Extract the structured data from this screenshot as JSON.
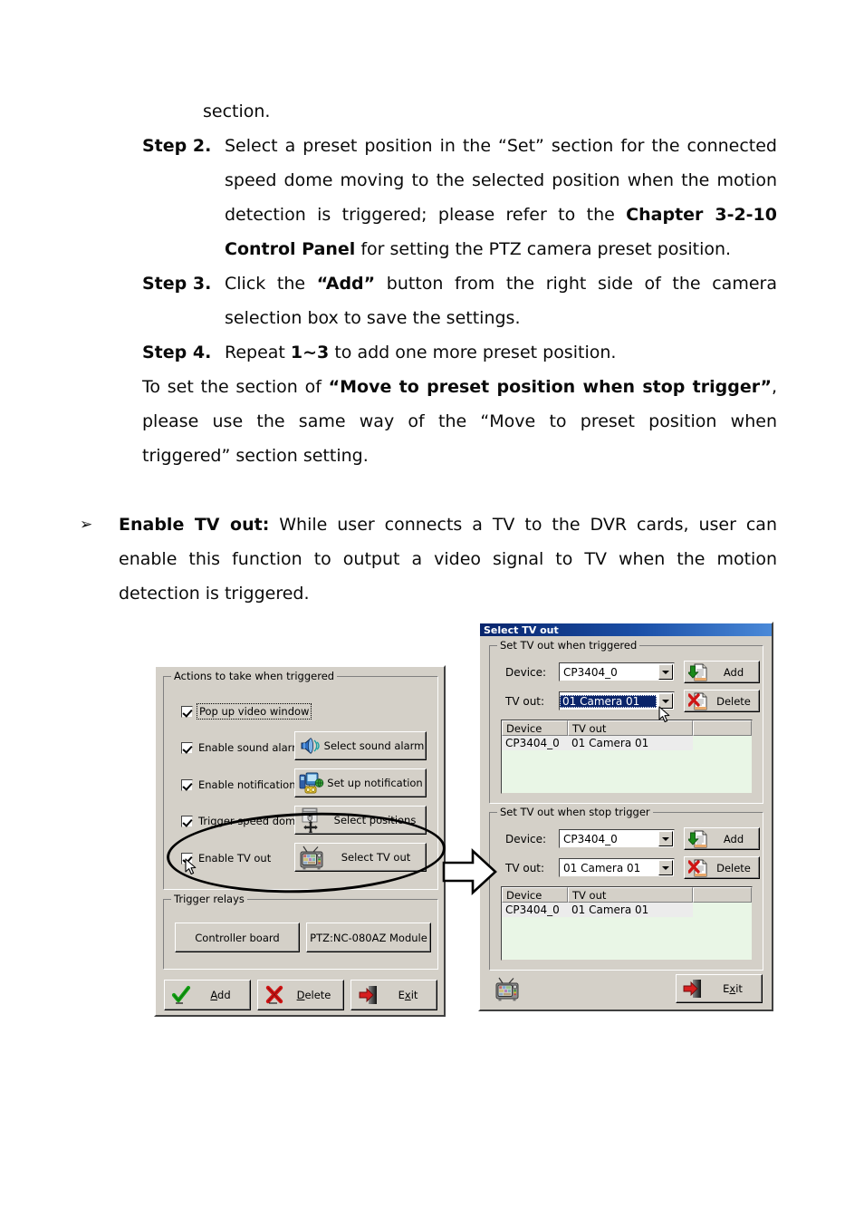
{
  "document": {
    "line_section": "section.",
    "steps": [
      {
        "label": "Step 2.",
        "segments": [
          {
            "t": "Select a preset position in the “Set” section for the connected speed dome moving to the selected position when the motion detection is triggered; please refer to the ",
            "bold": false
          },
          {
            "t": "Chapter 3-2-10 Control Panel",
            "bold": true
          },
          {
            "t": " for setting the PTZ camera preset position.",
            "bold": false
          }
        ]
      },
      {
        "label": "Step 3.",
        "segments": [
          {
            "t": "Click the ",
            "bold": false
          },
          {
            "t": "“Add”",
            "bold": true
          },
          {
            "t": " button from the right side of the camera selection box to save the settings.",
            "bold": false
          }
        ]
      },
      {
        "label": "Step 4.",
        "segments": [
          {
            "t": "Repeat ",
            "bold": false
          },
          {
            "t": "1~3",
            "bold": true
          },
          {
            "t": " to add one more preset position.",
            "bold": false
          }
        ]
      }
    ],
    "note_paragraph": {
      "segments": [
        {
          "t": "To set the section of ",
          "bold": false
        },
        {
          "t": "“Move to preset position when stop trigger”",
          "bold": true
        },
        {
          "t": ", please use the same way of the “Move to preset position when triggered” section setting.",
          "bold": false
        }
      ]
    },
    "bullet_paragraph": {
      "marker": "➢",
      "segments": [
        {
          "t": "Enable TV out:",
          "bold": true
        },
        {
          "t": " While user connects a TV to the DVR cards, user can enable this function to output a video signal to TV when the motion detection is triggered.",
          "bold": false
        }
      ]
    }
  },
  "left_dialog": {
    "group_actions_title": "Actions to take when triggered",
    "checkboxes": [
      {
        "label": "Pop up video window",
        "checked": true,
        "focused": true
      },
      {
        "label": "Enable sound alarm",
        "checked": true,
        "focused": false
      },
      {
        "label": "Enable notification",
        "checked": true,
        "focused": false
      },
      {
        "label": "Trigger speed dome",
        "checked": true,
        "focused": false
      },
      {
        "label": "Enable TV out",
        "checked": true,
        "focused": false
      }
    ],
    "action_buttons": [
      {
        "label": "Select sound alarm",
        "icon": "speaker-icon"
      },
      {
        "label": "Set up notification",
        "icon": "notification-icon"
      },
      {
        "label": "Select positions",
        "icon": "speed-dome-icon"
      },
      {
        "label": "Select TV out",
        "icon": "tv-icon"
      }
    ],
    "group_relays_title": "Trigger relays",
    "relay_buttons": [
      {
        "label": "Controller board"
      },
      {
        "label": "PTZ:NC-080AZ Module"
      }
    ],
    "footer_buttons": [
      {
        "label": "Add",
        "accel": "A",
        "icon": "green-check-icon"
      },
      {
        "label": "Delete",
        "accel": "D",
        "icon": "red-x-icon"
      },
      {
        "label": "Exit",
        "accel": "x",
        "icon": "exit-door-icon"
      }
    ]
  },
  "right_dialog": {
    "title": "Select TV out",
    "groups": [
      {
        "title": "Set TV out when triggered",
        "device_label": "Device:",
        "device_value": "CP3404_0",
        "tvout_label": "TV out:",
        "tvout_value": "01 Camera 01",
        "tvout_selected": true,
        "add_label": "Add",
        "delete_label": "Delete",
        "columns": [
          "Device",
          "TV out",
          ""
        ],
        "rows": [
          [
            "CP3404_0",
            "01 Camera 01",
            ""
          ]
        ]
      },
      {
        "title": "Set TV out when stop trigger",
        "device_label": "Device:",
        "device_value": "CP3404_0",
        "tvout_label": "TV out:",
        "tvout_value": "01 Camera 01",
        "tvout_selected": false,
        "add_label": "Add",
        "delete_label": "Delete",
        "columns": [
          "Device",
          "TV out",
          ""
        ],
        "rows": [
          [
            "CP3404_0",
            "01 Camera 01",
            ""
          ]
        ]
      }
    ],
    "footer_icon": "tv-icon",
    "exit_label": "Exit",
    "exit_accel": "x"
  },
  "annotations": {
    "highlight_ellipse": "ellipse-around-enable-tv-out",
    "flow_arrow": "arrow-pointing-right"
  },
  "colors": {
    "dialog_face": "#d4d0c8",
    "titlebar_start": "#08246b",
    "titlebar_end": "#4a89d8",
    "list_background": "#e9f6e6",
    "selection_blue": "#0a246a",
    "selected_row": "#ececec"
  }
}
